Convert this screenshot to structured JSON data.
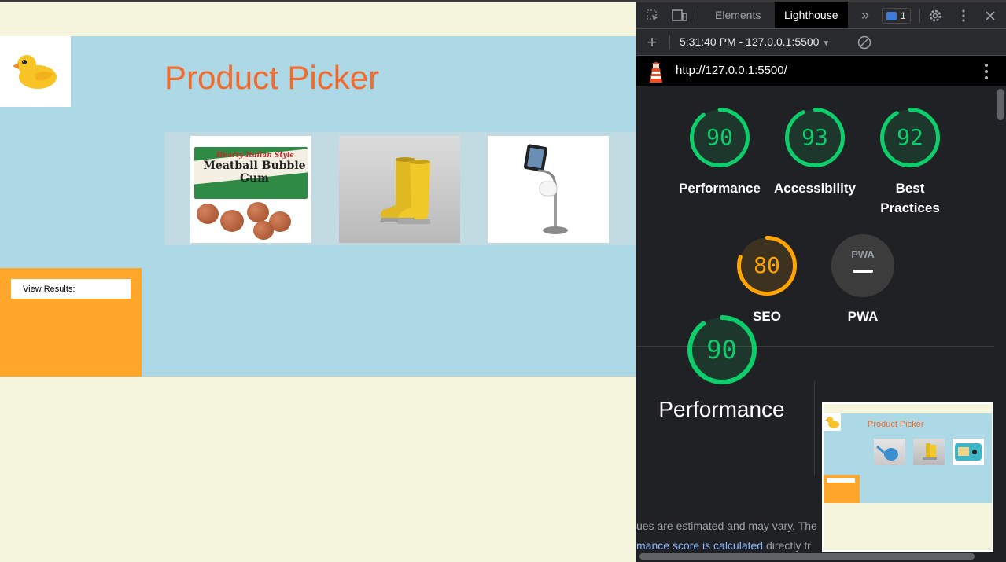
{
  "page": {
    "title": "Product Picker",
    "results_button_label": "View Results:",
    "products": [
      {
        "name": "meatball-bubble-gum",
        "line1": "Hearty Italian Style",
        "line2": "Meatball Bubble Gum"
      },
      {
        "name": "yellow-boots"
      },
      {
        "name": "ipad-toilet-paper-stand"
      }
    ],
    "colors": {
      "accent": "#f26b2c",
      "band": "#add8e6",
      "panel": "#ffa62b",
      "background": "#f5f4dc"
    }
  },
  "devtools": {
    "tabs": [
      "Elements",
      "Lighthouse"
    ],
    "active_tab": "Lighthouse",
    "message_count": "1",
    "run_label": "5:31:40 PM - 127.0.0.1:5500",
    "url": "http://127.0.0.1:5500/",
    "scores": [
      {
        "value": "90",
        "label": "Performance",
        "score": 90,
        "status": "pass"
      },
      {
        "value": "93",
        "label": "Accessibility",
        "score": 93,
        "status": "pass"
      },
      {
        "value": "92",
        "label": "Best Practices",
        "score": 92,
        "status": "pass"
      },
      {
        "value": "80",
        "label": "SEO",
        "score": 80,
        "status": "average"
      },
      {
        "value": "",
        "label": "PWA",
        "badge": "PWA",
        "status": "na"
      }
    ],
    "performance": {
      "value": "90",
      "label": "Performance",
      "score": 90
    },
    "note_text": "ues are estimated and may vary. The",
    "note_link": "mance score is calculated",
    "note_tail": " directly fr",
    "thumbnail_title": "Product Picker",
    "colors": {
      "pass": "#0cce6b",
      "average": "#ffa400"
    }
  }
}
